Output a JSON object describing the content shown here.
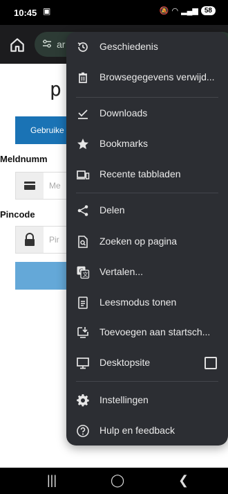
{
  "status": {
    "time": "10:45",
    "battery": "58"
  },
  "toolbar": {
    "url": "ar"
  },
  "page": {
    "logo": "p",
    "tab_button": "Gebruike",
    "label_meldnummer": "Meldnumm",
    "placeholder_meldnummer": "Me",
    "label_pincode": "Pincode",
    "placeholder_pincode": "Pir"
  },
  "menu": {
    "history": "Geschiedenis",
    "clear_data": "Browsegegevens verwijd...",
    "downloads": "Downloads",
    "bookmarks": "Bookmarks",
    "recent_tabs": "Recente tabbladen",
    "share": "Delen",
    "find_in_page": "Zoeken op pagina",
    "translate": "Vertalen...",
    "reader_mode": "Leesmodus tonen",
    "add_to_home": "Toevoegen aan startsch...",
    "desktop_site": "Desktopsite",
    "settings": "Instellingen",
    "help": "Hulp en feedback"
  },
  "colors": {
    "menu_bg": "#2c2e33",
    "primary_blue": "#1a73b5",
    "toolbar_bg": "#1c1c1e"
  }
}
